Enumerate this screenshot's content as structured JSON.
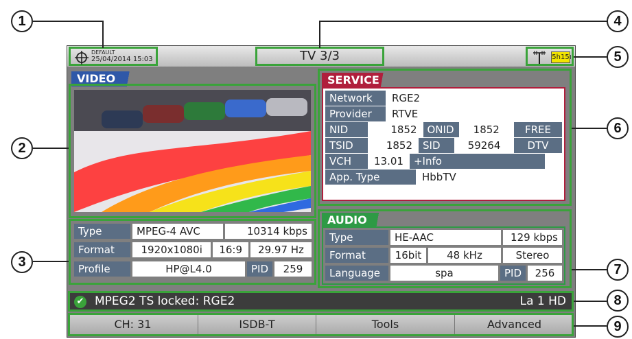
{
  "topbar": {
    "preset": "DEFAULT",
    "datetime": "25/04/2014 15:03",
    "title": "TV 3/3",
    "battery": "5h15"
  },
  "video": {
    "tab": "VIDEO",
    "rows": [
      [
        "Type",
        "MPEG-4 AVC",
        "10314 kbps"
      ],
      [
        "Format",
        "1920x1080i",
        "16:9",
        "29.97 Hz"
      ],
      [
        "Profile",
        "HP@L4.0",
        "PID",
        "259"
      ]
    ]
  },
  "service": {
    "tab": "SERVICE",
    "network_label": "Network",
    "network": "RGE2",
    "provider_label": "Provider",
    "provider": "RTVE",
    "nid_label": "NID",
    "nid": "1852",
    "onid_label": "ONID",
    "onid": "1852",
    "free": "FREE",
    "tsid_label": "TSID",
    "tsid": "1852",
    "sid_label": "SID",
    "sid": "59264",
    "dtv": "DTV",
    "vch_label": "VCH",
    "vch": "13.01",
    "info": "+Info",
    "apptype_label": "App. Type",
    "apptype": "HbbTV"
  },
  "audio": {
    "tab": "AUDIO",
    "type_label": "Type",
    "type": "HE-AAC",
    "rate": "129 kbps",
    "format_label": "Format",
    "bits": "16bit",
    "freq": "48 kHz",
    "mode": "Stereo",
    "language_label": "Language",
    "language": "spa",
    "pid_label": "PID",
    "pid": "256"
  },
  "status": {
    "text": "MPEG2 TS locked: RGE2",
    "channel_name": "La 1 HD"
  },
  "softkeys": [
    "CH: 31",
    "ISDB-T",
    "Tools",
    "Advanced"
  ],
  "callouts": [
    "1",
    "2",
    "3",
    "4",
    "5",
    "6",
    "7",
    "8",
    "9"
  ],
  "colors": {
    "highlight": "#3aa33a",
    "video_tab": "#2f58a8",
    "service_tab": "#b01e3c",
    "audio_tab": "#2e9a45",
    "label_bg": "#5b6e84"
  }
}
